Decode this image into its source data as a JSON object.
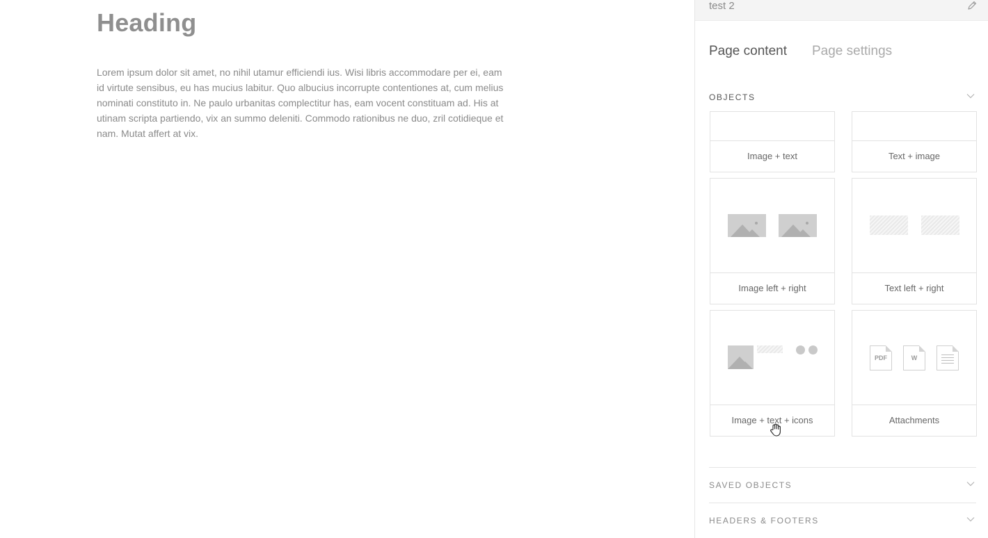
{
  "canvas": {
    "heading": "Heading",
    "paragraph": "Lorem ipsum dolor sit amet, no nihil utamur efficiendi ius. Wisi libris accommodare per ei, eam id virtute sensibus, eu has mucius labitur. Quo albucius incorrupte contentiones at, cum melius nominati constituto in. Ne paulo urbanitas complectitur has, eam vocent constituam ad. His at utinam scripta partiendo, vix an summo deleniti. Commodo rationibus ne duo, zril cotidieque et nam. Mutat affert at vix."
  },
  "sidebar": {
    "page_name": "test 2",
    "tabs": [
      {
        "label": "Page content",
        "active": true
      },
      {
        "label": "Page settings",
        "active": false
      }
    ],
    "sections": {
      "objects": "OBJECTS",
      "saved_objects": "SAVED OBJECTS",
      "headers_footers": "HEADERS & FOOTERS"
    },
    "tiles": [
      {
        "label": "Image + text"
      },
      {
        "label": "Text + image"
      },
      {
        "label": "Image left + right"
      },
      {
        "label": "Text left + right"
      },
      {
        "label": "Image + text + icons"
      },
      {
        "label": "Attachments"
      }
    ],
    "attachment_icons": [
      "PDF",
      "W"
    ]
  },
  "icons": {
    "edit": "pencil-icon",
    "collapse": "chevron-down-icon",
    "cursor": "hand-cursor-icon"
  },
  "colors": {
    "heading": "#8f8f8f",
    "text": "#8a8a8a",
    "topbar": "#f4f4f4",
    "border": "#e2e2e2",
    "placeholder": "#cfcfcf"
  }
}
